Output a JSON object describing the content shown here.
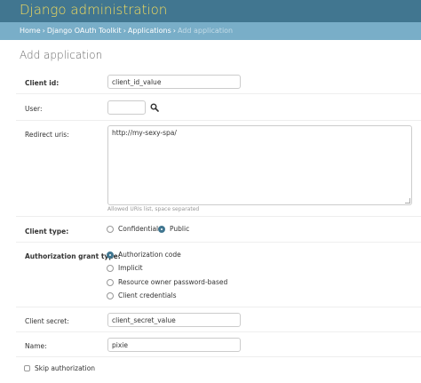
{
  "site": {
    "title": "Django administration"
  },
  "breadcrumbs": {
    "home": "Home",
    "app": "Django OAuth Toolkit",
    "model": "Applications",
    "current": "Add application",
    "separator": "›"
  },
  "page": {
    "title": "Add application"
  },
  "form": {
    "client_id": {
      "label": "Client id:",
      "value": "client_id_value"
    },
    "user": {
      "label": "User:",
      "value": "",
      "lookup_icon": "search-icon"
    },
    "redirect_uris": {
      "label": "Redirect uris:",
      "value": "http://my-sexy-spa/",
      "help": "Allowed URIs list, space separated"
    },
    "client_type": {
      "label": "Client type:",
      "options": [
        "Confidential",
        "Public"
      ],
      "selected": "Public"
    },
    "grant_type": {
      "label": "Authorization grant type:",
      "options": [
        "Authorization code",
        "Implicit",
        "Resource owner password-based",
        "Client credentials"
      ],
      "selected": "Authorization code"
    },
    "client_secret": {
      "label": "Client secret:",
      "value": "client_secret_value"
    },
    "name": {
      "label": "Name:",
      "value": "pixie"
    },
    "skip_authorization": {
      "label": "Skip authorization",
      "checked": false
    }
  },
  "colors": {
    "header_bg": "#417690",
    "title": "#f5dd5d",
    "breadcrumb_bg": "#79aec8",
    "radio_selected": "#417690"
  }
}
